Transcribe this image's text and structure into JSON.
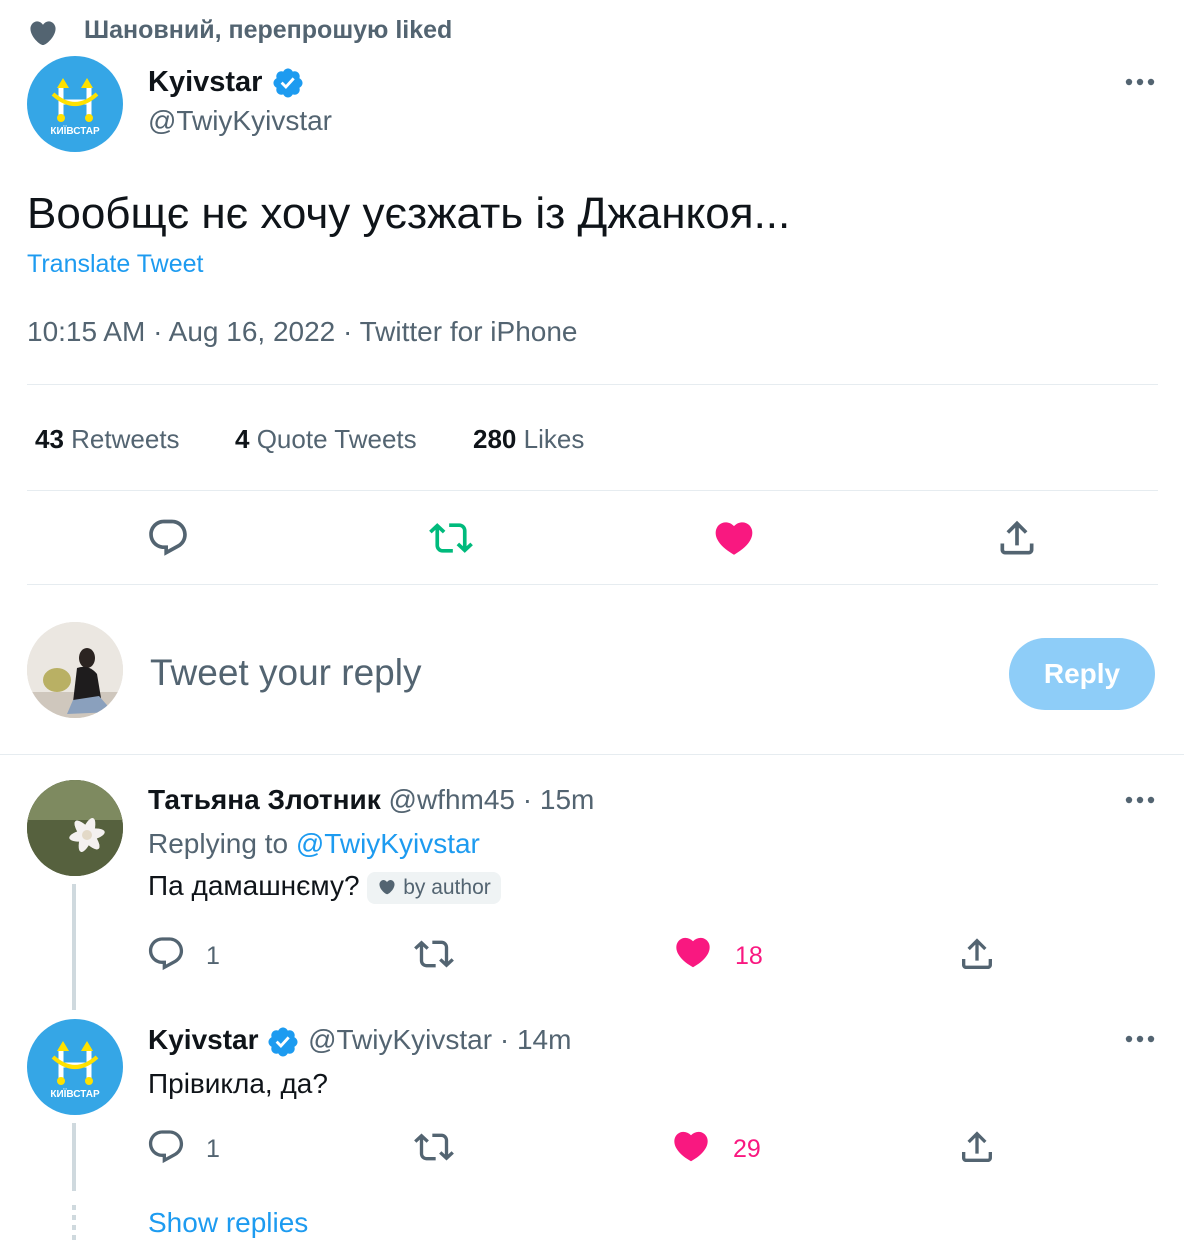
{
  "social_context": {
    "text": "Шановний, перепрошую liked",
    "icon": "heart-icon"
  },
  "main_tweet": {
    "author": {
      "name": "Kyivstar",
      "handle": "@TwiyKyivstar",
      "logo_text": "КИЇВСТАР",
      "verified": true
    },
    "text": "Вообщє нє хочу уєзжать із Джанкоя...",
    "translate_label": "Translate Tweet",
    "meta": "10:15 AM · Aug 16, 2022 · Twitter for iPhone",
    "stats": [
      {
        "count": "43",
        "label": "Retweets"
      },
      {
        "count": "4",
        "label": "Quote Tweets"
      },
      {
        "count": "280",
        "label": "Likes"
      }
    ],
    "liked": true
  },
  "composer": {
    "placeholder": "Tweet your reply",
    "button_label": "Reply"
  },
  "replies": [
    {
      "name": "Татьяна Злотник",
      "handle": "@wfhm45",
      "time": "· 15m",
      "replying_prefix": "Replying to",
      "replying_to": "@TwiyKyivstar",
      "text": "Па дамашнєму?",
      "badge": "by author",
      "replies": "1",
      "likes": "18"
    },
    {
      "name": "Kyivstar",
      "handle": "@TwiyKyivstar",
      "time": "· 14m",
      "logo_text": "КИЇВСТАР",
      "text": "Прівикла, да?",
      "replies": "1",
      "likes": "29"
    }
  ],
  "show_replies_label": "Show replies",
  "colors": {
    "accent": "#1d9bf0",
    "like": "#f91880",
    "retweet": "#00ba7c",
    "muted": "#536471",
    "reply_button": "#8ecdf8"
  }
}
